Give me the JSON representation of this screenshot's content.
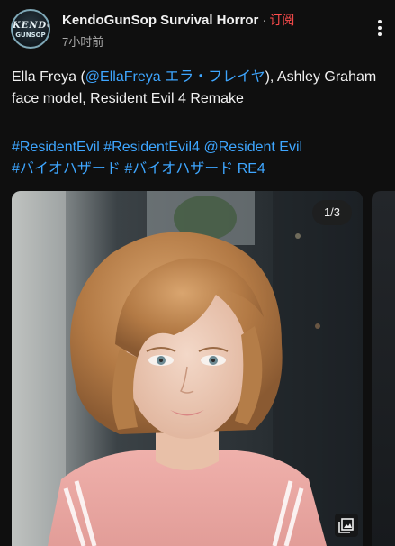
{
  "channel": {
    "name": "KendoGunSop Survival Horror",
    "separator": "·",
    "subscribe_label": "订阅",
    "timestamp": "7小时前",
    "avatar_logo_top": "KENDO",
    "avatar_logo_bottom": "GUNSOP"
  },
  "post": {
    "text_prefix": "Ella Freya (",
    "mention": "@EllaFreya エラ・フレイヤ",
    "text_suffix": "), Ashley Graham face model, Resident Evil 4 Remake",
    "hashtags": {
      "tag1": "#ResidentEvil",
      "tag2": "#ResidentEvil4",
      "tag3": "@Resident Evil",
      "tag4": "#バイオハザード",
      "tag5": "#バイオハザード RE4"
    }
  },
  "gallery": {
    "counter": "1/3",
    "current_index": 1,
    "total": 3
  },
  "icons": {
    "more": "more-vert-icon",
    "gallery": "photo-library-icon"
  },
  "colors": {
    "background": "#0f0f0f",
    "text": "#f1f1f1",
    "link": "#3ea6ff",
    "subscribe": "#ff4d4d",
    "muted": "#aaaaaa"
  }
}
